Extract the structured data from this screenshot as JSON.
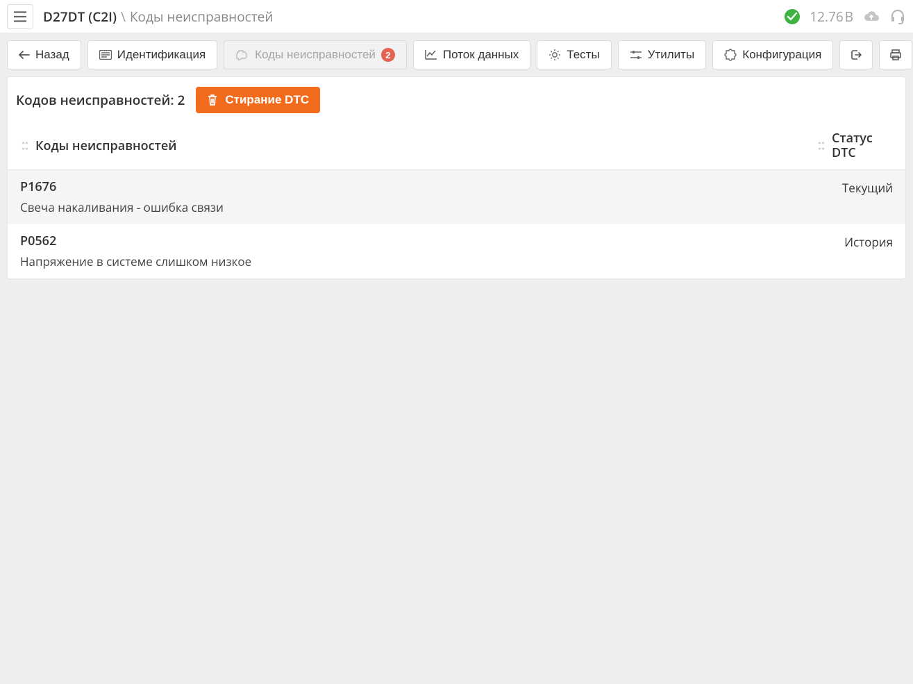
{
  "header": {
    "device": "D27DT (C2I)",
    "page": "Коды неисправностей",
    "voltage_value": "12.76",
    "voltage_unit": "В"
  },
  "toolbar": {
    "back": "Назад",
    "identification": "Идентификация",
    "fault_codes": "Коды неисправностей",
    "fault_codes_badge": "2",
    "data_stream": "Поток данных",
    "tests": "Тесты",
    "utilities": "Утилиты",
    "configuration": "Конфигурация"
  },
  "panel": {
    "title_prefix": "Кодов неисправностей:",
    "count": "2",
    "erase_label": "Стирание DTC"
  },
  "table": {
    "header_codes": "Коды неисправностей",
    "header_status_line1": "Статус",
    "header_status_line2": "DTC",
    "rows": [
      {
        "code": "P1676",
        "desc": "Свеча накаливания - ошибка связи",
        "status": "Текущий"
      },
      {
        "code": "P0562",
        "desc": "Напряжение в системе слишком низкое",
        "status": "История"
      }
    ]
  }
}
